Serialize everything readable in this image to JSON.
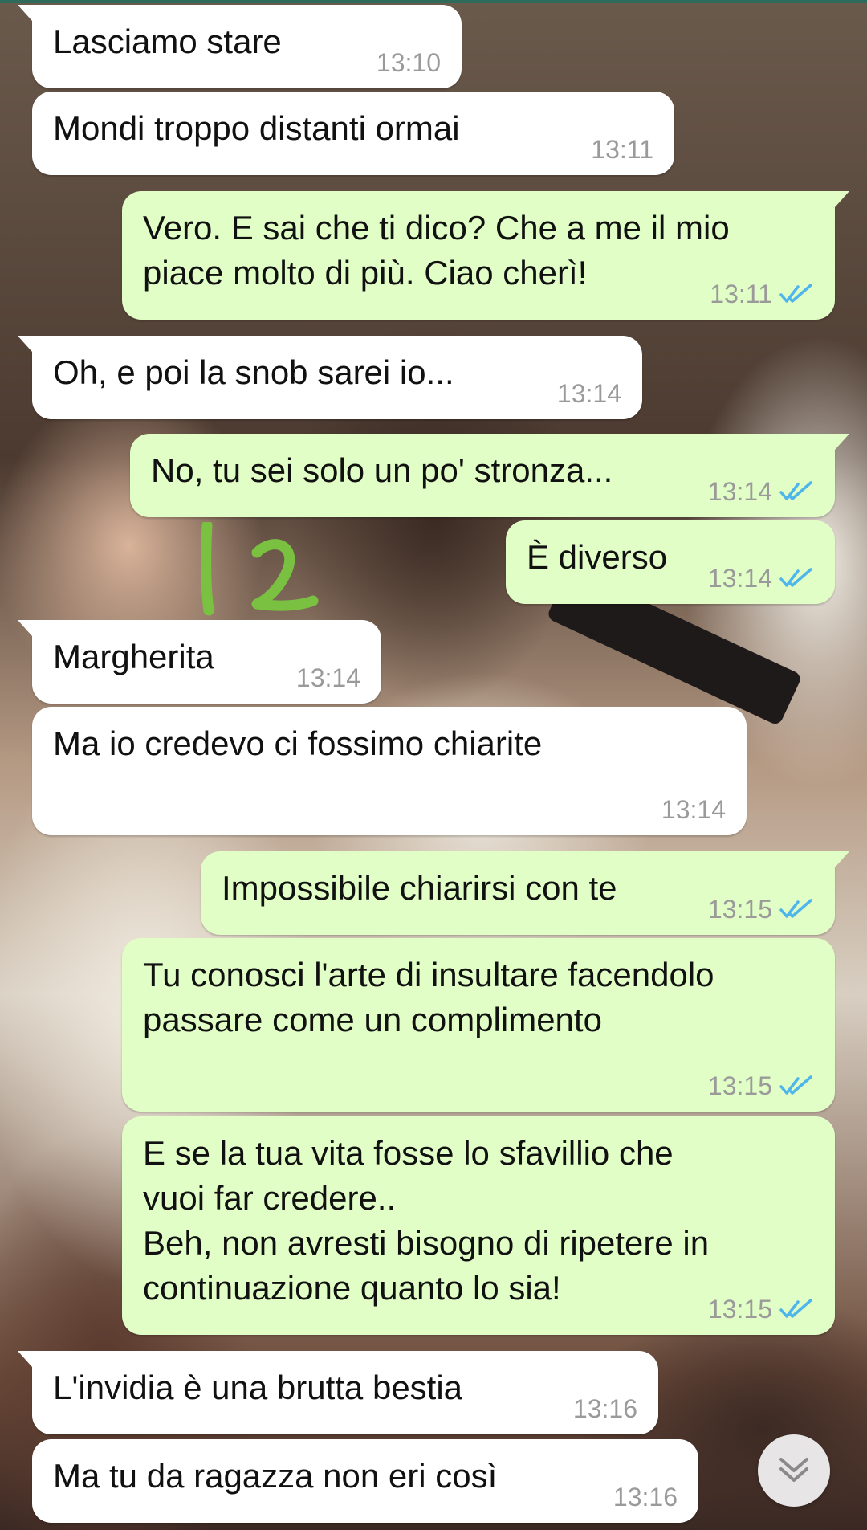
{
  "chat": {
    "messages": [
      {
        "dir": "in",
        "text": "Lasciamo stare",
        "time": "13:10"
      },
      {
        "dir": "in",
        "text": "Mondi troppo distanti ormai",
        "time": "13:11"
      },
      {
        "dir": "out",
        "text": "Vero. E sai che ti dico? Che a me il mio\npiace molto di più. Ciao cherì!",
        "time": "13:11",
        "status": "read"
      },
      {
        "dir": "in",
        "text": "Oh, e poi la snob sarei io...",
        "time": "13:14"
      },
      {
        "dir": "out",
        "text": "No, tu sei solo un po' stronza...",
        "time": "13:14",
        "status": "read"
      },
      {
        "dir": "out",
        "text": "È diverso",
        "time": "13:14",
        "status": "read"
      },
      {
        "dir": "in",
        "text": "Margherita",
        "time": "13:14"
      },
      {
        "dir": "in",
        "text": "Ma io credevo ci fossimo chiarite",
        "time": "13:14"
      },
      {
        "dir": "out",
        "text": "Impossibile chiarirsi con te",
        "time": "13:15",
        "status": "read"
      },
      {
        "dir": "out",
        "text": "Tu conosci l'arte di insultare facendolo\npassare come un complimento",
        "time": "13:15",
        "status": "read"
      },
      {
        "dir": "out",
        "text": "E se la tua vita fosse lo sfavillio che\nvuoi far credere..\nBeh, non avresti bisogno di ripetere in\ncontinuazione quanto lo sia!",
        "time": "13:15",
        "status": "read"
      },
      {
        "dir": "in",
        "text": "L'invidia è una brutta bestia",
        "time": "13:16"
      },
      {
        "dir": "in",
        "text": "Ma tu da ragazza non eri così",
        "time": "13:16"
      }
    ]
  },
  "scribble_annotation": "12",
  "icons": {
    "read_receipt": "double-check-icon",
    "scroll_down": "chevron-down-double-icon"
  },
  "colors": {
    "incoming_bubble": "#ffffff",
    "outgoing_bubble": "#e1fec6",
    "read_tick": "#4fb6ec",
    "timestamp": "#9a9a9a",
    "scribble": "#7ac142"
  }
}
